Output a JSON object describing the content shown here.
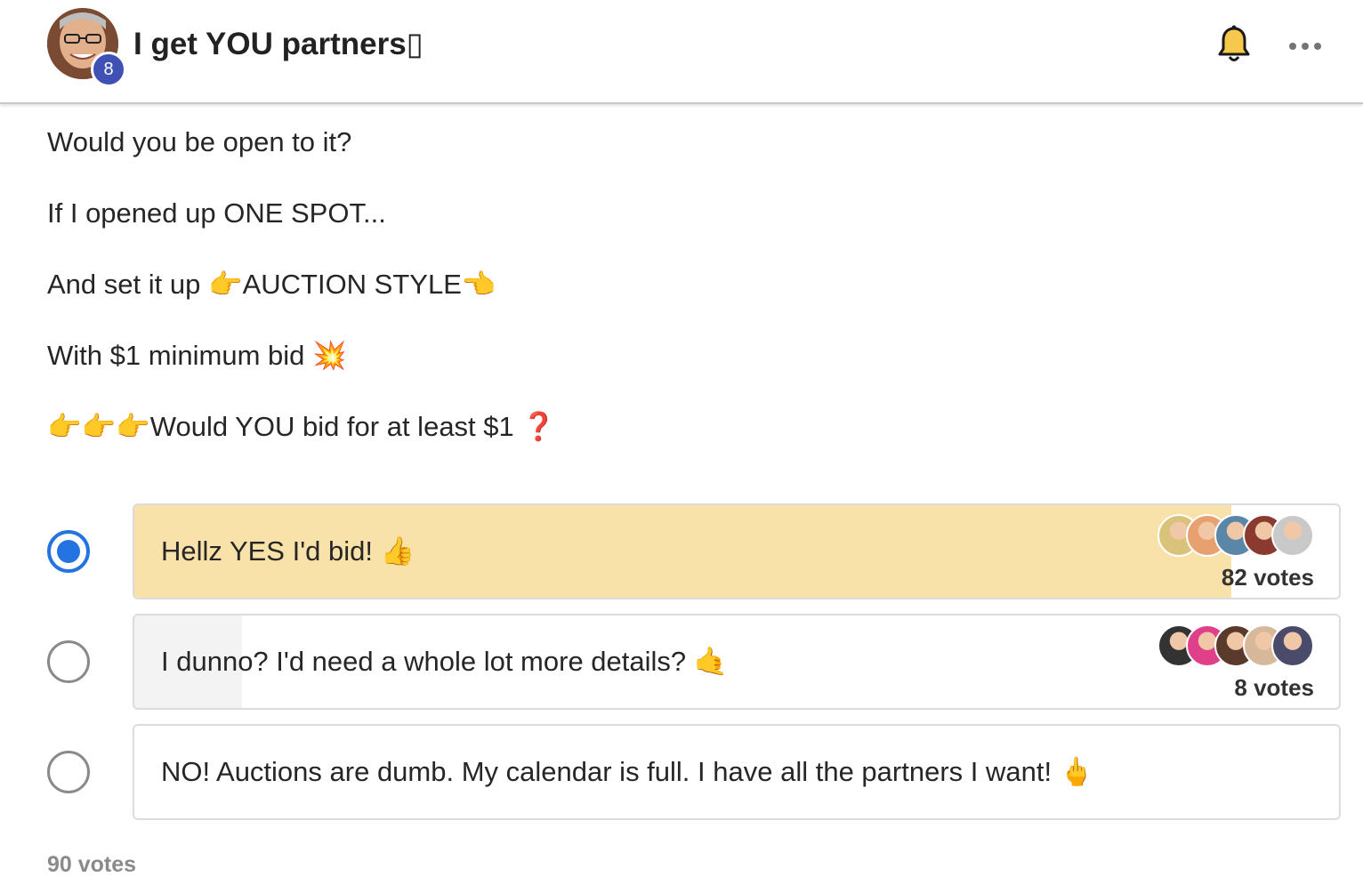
{
  "header": {
    "group_title": "I get YOU partners▯",
    "level_badge": "8",
    "icons": [
      "avatar",
      "bell-icon",
      "more-icon"
    ]
  },
  "post": {
    "lines": [
      {
        "text": "Would you be open to it?"
      },
      {
        "text": "If I opened up ONE SPOT..."
      },
      {
        "pre": "And set it up ",
        "emoji1": "👉",
        "mid": "AUCTION STYLE",
        "emoji2": "👈"
      },
      {
        "pre": "With $1 minimum bid ",
        "emoji": "💥"
      },
      {
        "emojis": "👉👉👉",
        "text": "Would YOU bid for at least $1 ",
        "emoji": "❓"
      }
    ]
  },
  "poll": {
    "options": [
      {
        "label": "Hellz YES I'd bid! ",
        "emoji": "👍",
        "votes": "82 votes",
        "share": 0.911,
        "selected": true,
        "fill_color": "#f8e2a9",
        "voter_colors": [
          "#d9c27a",
          "#e8a070",
          "#5a86a8",
          "#8a3a2e",
          "#c9c9c9"
        ]
      },
      {
        "label": "I dunno? I'd need a whole lot more details? ",
        "emoji": "🤙",
        "votes": "8 votes",
        "share": 0.089,
        "selected": false,
        "fill_color": "#f3f3f3",
        "voter_colors": [
          "#333333",
          "#e0408a",
          "#5a3a2a",
          "#d8b89a",
          "#4a4a6a"
        ]
      },
      {
        "label": "NO! Auctions are dumb. My calendar is full. I have all the partners I want! ",
        "emoji": "🖕",
        "votes": "",
        "share": 0,
        "selected": false,
        "fill_color": "#ffffff",
        "voter_colors": []
      }
    ],
    "total_votes": "90 votes"
  },
  "colors": {
    "accent": "#2374e1",
    "badge": "#3f51b5",
    "winning_fill": "#f8e2a9"
  }
}
